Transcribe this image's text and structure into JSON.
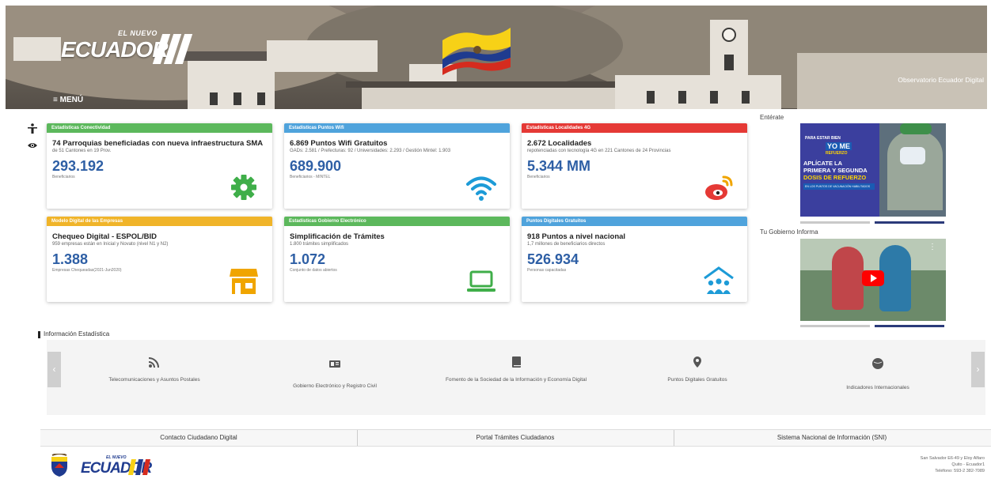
{
  "header": {
    "logo_small": "EL NUEVO",
    "logo_big": "ECUADOR",
    "menu_label": "≡ MENÚ",
    "observatorio": "Observatorio Ecuador Digital"
  },
  "cards": [
    {
      "tag": "Estadísticas Conectividad",
      "title": "74 Parroquias beneficiadas con nueva infraestructura SMA",
      "sub": "de 51 Cantones en 19 Prov.",
      "num": "293.192",
      "cap": "Beneficiarios",
      "icon": "gear-icon",
      "color": "#5cb85c"
    },
    {
      "tag": "Estadísticas Puntos Wifi",
      "title": "6.869 Puntos Wifi Gratuitos",
      "sub": "GADs: 2.581 / Prefecturas: 92 / Universidades: 2.293 / Gestión Mintel: 1.903",
      "num": "689.900",
      "cap": "Beneficiarios - MINTEL",
      "icon": "wifi-icon",
      "color": "#4fa3dc"
    },
    {
      "tag": "Estadísticas Localidades 4G",
      "title": "2.672 Localidades",
      "sub": "repotenciadas con tecnología 4G en 221 Cantones de 24 Provincias",
      "num": "5.344 MM",
      "cap": "Beneficiarios",
      "icon": "signal-icon",
      "color": "#e53935"
    },
    {
      "tag": "Modelo Digital de las Empresas",
      "title": "Chequeo Digital - ESPOL/BID",
      "sub": "959 empresas están en Inicial y Novato (nivel N1 y N2)",
      "num": "1.388",
      "cap": "Empresas Chequeadas(2021-Jun2020)",
      "icon": "store-icon",
      "color": "#f0b429"
    },
    {
      "tag": "Estadísticas Gobierno Electrónico",
      "title": "Simplificación de Trámites",
      "sub": "1.800 trámites simplificados",
      "num": "1.072",
      "cap": "Conjunto de datos abiertos",
      "icon": "laptop-icon",
      "color": "#5cb85c"
    },
    {
      "tag": "Puntos Digitales Gratuitos",
      "title": "918 Puntos a nivel nacional",
      "sub": "1,7 millones de beneficiarios directos",
      "num": "526.934",
      "cap": "Personas capacitadas",
      "icon": "community-icon",
      "color": "#4fa3dc"
    }
  ],
  "right": {
    "enterate_label": "Entérate",
    "gobierno_label": "Tu Gobierno Informa",
    "video1_lines": [
      "PARA ESTAR BIEN",
      "YO ME",
      "REFUERZO",
      "APLÍCATE LA",
      "PRIMERA Y SEGUNDA",
      "DOSIS DE REFUERZO",
      "EN LOS PUNTOS DE VACUNACIÓN HABILITADOS"
    ]
  },
  "info": {
    "title": "Información Estadística",
    "categories": [
      {
        "label": "Telecomunicaciones y Asuntos Postales",
        "icon": "rss-icon"
      },
      {
        "label": "Gobierno Electrónico y Registro Civil",
        "icon": "id-card-icon"
      },
      {
        "label": "Fomento de la Sociedad de la Información y Economía Digital",
        "icon": "book-icon"
      },
      {
        "label": "Puntos Digitales Gratuitos",
        "icon": "map-pin-icon"
      },
      {
        "label": "Indicadores Internacionales",
        "icon": "globe-icon"
      }
    ]
  },
  "footer_links": [
    "Contacto Ciudadano Digital",
    "Portal Trámites Ciudadanos",
    "Sistema Nacional de Información (SNI)"
  ],
  "address": {
    "line1": "San Salvador E6-49 y Eloy Alfaro",
    "line2": "Quito - Ecuador1",
    "line3": "Teléfono: 593-2 382-7089"
  },
  "bottom_logo": {
    "small": "EL NUEVO",
    "big": "ECUADOR"
  }
}
